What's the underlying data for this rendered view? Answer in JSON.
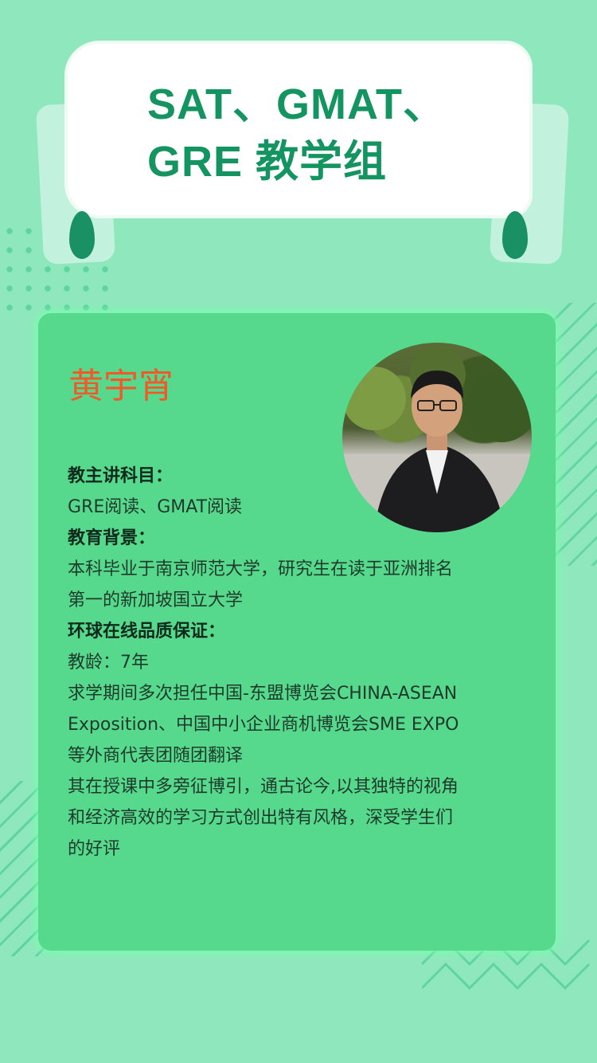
{
  "banner": {
    "title_line1": "SAT、GMAT、",
    "title_line2": "GRE  教学组"
  },
  "teacher": {
    "name": "黄宇宵",
    "photo_icon": "portrait-photo",
    "sections": [
      {
        "heading": "教主讲科目：",
        "lines": [
          "GRE阅读、GMAT阅读"
        ]
      },
      {
        "heading": "教育背景：",
        "lines": [
          "本科毕业于南京师范大学，研究生在读于亚洲排名",
          "第一的新加坡国立大学"
        ]
      },
      {
        "heading": "环球在线品质保证：",
        "lines": [
          "教龄：7年",
          "求学期间多次担任中国-东盟博览会CHINA-ASEAN",
          "Exposition、中国中小企业商机博览会SME EXPO",
          "等外商代表团随团翻译",
          "其在授课中多旁征博引，通古论今,以其独特的视角",
          "和经济高效的学习方式创出特有风格，深受学生们",
          "的好评"
        ]
      }
    ]
  },
  "colors": {
    "background": "#8fe8bd",
    "card": "#56d98c",
    "title": "#139460",
    "name": "#f05a2a"
  }
}
